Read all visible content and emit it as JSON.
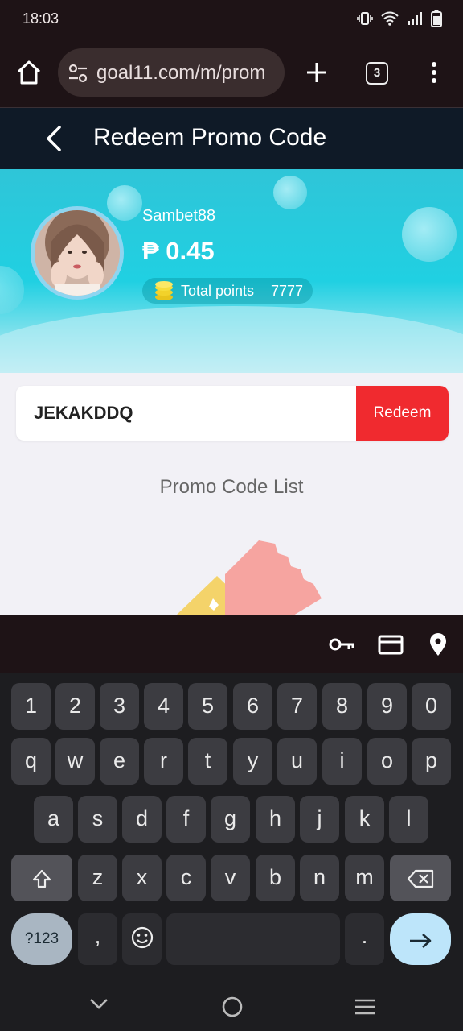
{
  "status_bar": {
    "time": "18:03",
    "icons": [
      "vibrate-icon",
      "wifi-icon",
      "signal-icon",
      "battery-icon"
    ]
  },
  "browser": {
    "url": "goal11.com/m/prom",
    "tab_count": "3",
    "icons": [
      "home-icon",
      "site-settings-icon",
      "plus-icon",
      "more-vert-icon"
    ]
  },
  "header": {
    "title": "Redeem Promo Code"
  },
  "profile": {
    "username": "Sambet88",
    "balance": "₱ 0.45",
    "points_label": "Total points",
    "points_value": "7777"
  },
  "promo": {
    "code_value": "JEKAKDDQ",
    "redeem_label": "Redeem",
    "list_title": "Promo Code List"
  },
  "keyboard": {
    "toolbar_icons": [
      "key-icon",
      "credit-card-icon",
      "location-pin-icon"
    ],
    "row_numbers": [
      "1",
      "2",
      "3",
      "4",
      "5",
      "6",
      "7",
      "8",
      "9",
      "0"
    ],
    "row_top": [
      "q",
      "w",
      "e",
      "r",
      "t",
      "y",
      "u",
      "i",
      "o",
      "p"
    ],
    "row_mid": [
      "a",
      "s",
      "d",
      "f",
      "g",
      "h",
      "j",
      "k",
      "l"
    ],
    "row_bottom": [
      "z",
      "x",
      "c",
      "v",
      "b",
      "n",
      "m"
    ],
    "symbols_key": "?123",
    "comma_key": ",",
    "period_key": "."
  },
  "colors": {
    "redeem": "#f02a2f",
    "banner": "#20d0e2",
    "header": "#0f1a27"
  }
}
